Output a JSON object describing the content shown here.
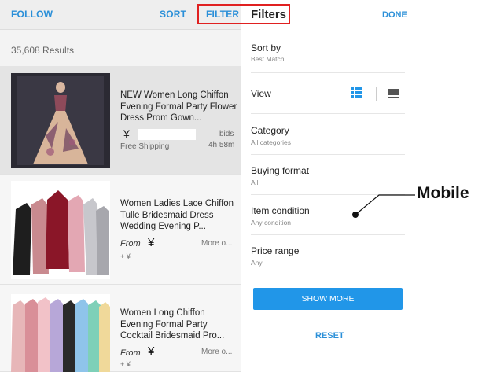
{
  "left_panel": {
    "follow_label": "FOLLOW",
    "sort_label": "SORT",
    "filter_label": "FILTER",
    "results_count": "35,608 Results",
    "listings": [
      {
        "title": "NEW Women Long Chiffon Evening Formal Party Flower Dress Prom Gown...",
        "price_symbol": "¥",
        "bids_label": "bids",
        "time_left": "4h 58m",
        "shipping": "Free Shipping"
      },
      {
        "title": "Women Ladies Lace Chiffon Tulle Bridesmaid Dress Wedding Evening P...",
        "from_label": "From",
        "price_symbol": "¥",
        "more_label": "More o...",
        "shipping_extra": "+ ¥"
      },
      {
        "title": "Women Long Chiffon Evening Formal Party Cocktail Bridesmaid Pro...",
        "from_label": "From",
        "price_symbol": "¥",
        "more_label": "More o...",
        "shipping_extra": "+ ¥"
      }
    ]
  },
  "filters_panel": {
    "title": "Filters",
    "done_label": "DONE",
    "rows": {
      "sort_by": {
        "label": "Sort by",
        "value": "Best Match"
      },
      "view": {
        "label": "View"
      },
      "category": {
        "label": "Category",
        "value": "All categories"
      },
      "buying_format": {
        "label": "Buying format",
        "value": "All"
      },
      "item_condition": {
        "label": "Item condition",
        "value": "Any condition"
      },
      "price_range": {
        "label": "Price range",
        "value": "Any"
      }
    },
    "show_more_label": "SHOW MORE",
    "reset_label": "RESET"
  },
  "annotation": {
    "label": "Mobile",
    "highlight_color": "#e02020"
  },
  "colors": {
    "accent": "#2196e8",
    "link": "#2a8fd8"
  }
}
